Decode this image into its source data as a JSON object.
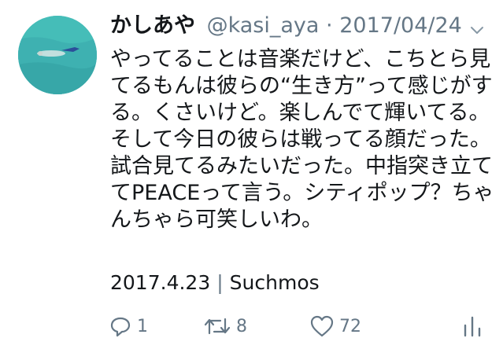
{
  "tweet": {
    "author_name": "かしあや",
    "author_handle": "@kasi_aya",
    "separator": "·",
    "date": "2017/04/24",
    "text": "やってることは音楽だけど、こちとら見てるもんは彼らの“生き方”って感じがする。くさいけど。楽しんでて輝いてる。そして今日の彼らは戦ってる顔だった。試合見てるみたいだった。中指突き立ててPEACEって言う。シティポップ？ちゃんちゃら可笑しいわ。",
    "meta_date": "2017.4.23",
    "meta_separator": "|",
    "meta_tag": "Suchmos"
  },
  "actions": {
    "reply_icon": "reply-icon",
    "reply_count": "1",
    "retweet_icon": "retweet-icon",
    "retweet_count": "8",
    "like_icon": "heart-icon",
    "like_count": "72",
    "analytics_icon": "analytics-icon"
  },
  "colors": {
    "text": "#14171a",
    "secondary": "#657786",
    "avatar_water": "#3fb7b4"
  }
}
